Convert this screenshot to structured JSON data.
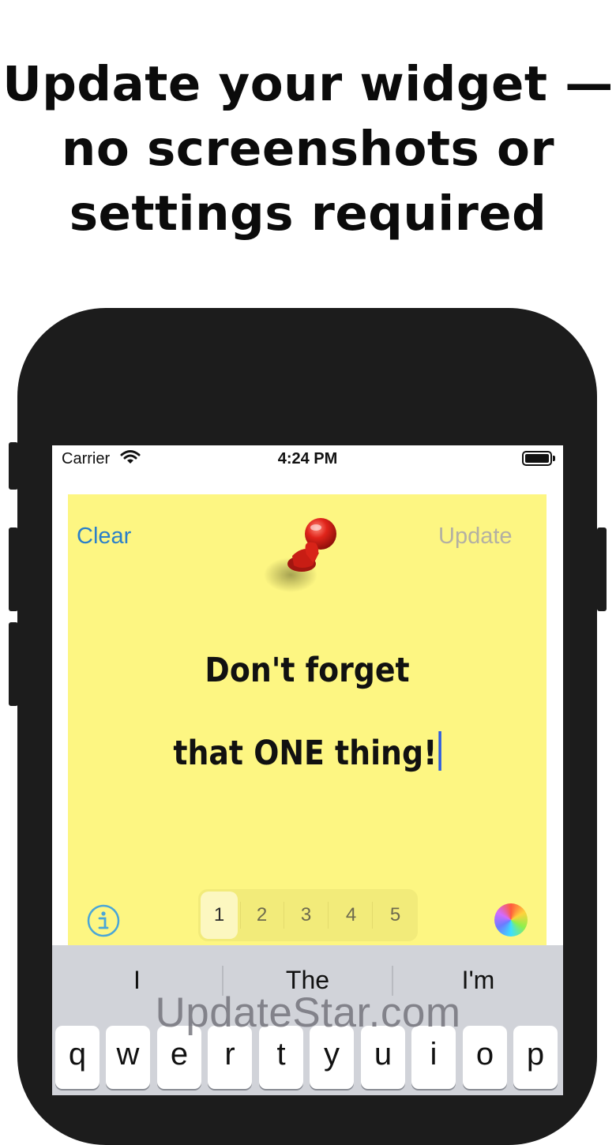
{
  "headline": {
    "line1": "Update your widget —",
    "line2": "no screenshots or",
    "line3": "settings required"
  },
  "status_bar": {
    "carrier": "Carrier",
    "time": "4:24 PM"
  },
  "toolbar": {
    "clear_label": "Clear",
    "update_label": "Update"
  },
  "note": {
    "line1": "Don't forget",
    "line2": "that ONE thing!",
    "background_color": "#fdf682"
  },
  "pages": [
    "1",
    "2",
    "3",
    "4",
    "5"
  ],
  "selected_page": "1",
  "suggestions": [
    "I",
    "The",
    "I'm"
  ],
  "keyboard_row": [
    "q",
    "w",
    "e",
    "r",
    "t",
    "y",
    "u",
    "i",
    "o",
    "p"
  ],
  "watermark": "UpdateStar.com",
  "colors": {
    "accent": "#2a7fc9",
    "disabled": "#b3b0a3",
    "cursor": "#2c5be0"
  }
}
